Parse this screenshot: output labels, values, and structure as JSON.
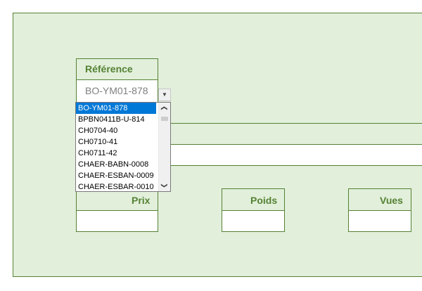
{
  "fields": {
    "reference": {
      "label": "Référence",
      "value": "BO-YM01-878"
    },
    "prix": {
      "label": "Prix"
    },
    "poids": {
      "label": "Poids"
    },
    "vues": {
      "label": "Vues"
    }
  },
  "dropdown": {
    "selected_index": 0,
    "options": [
      "BO-YM01-878",
      "BPBN0411B-U-814",
      "CH0704-40",
      "CH0710-41",
      "CH0711-42",
      "CHAER-BABN-0008",
      "CHAER-ESBAN-0009",
      "CHAER-ESBAR-0010"
    ],
    "scroll_up_icon": "chevron-up-icon",
    "scroll_down_icon": "chevron-down-icon"
  },
  "colors": {
    "panel_bg": "#e2efda",
    "border": "#548235",
    "label": "#548235",
    "selection": "#0078d7"
  }
}
